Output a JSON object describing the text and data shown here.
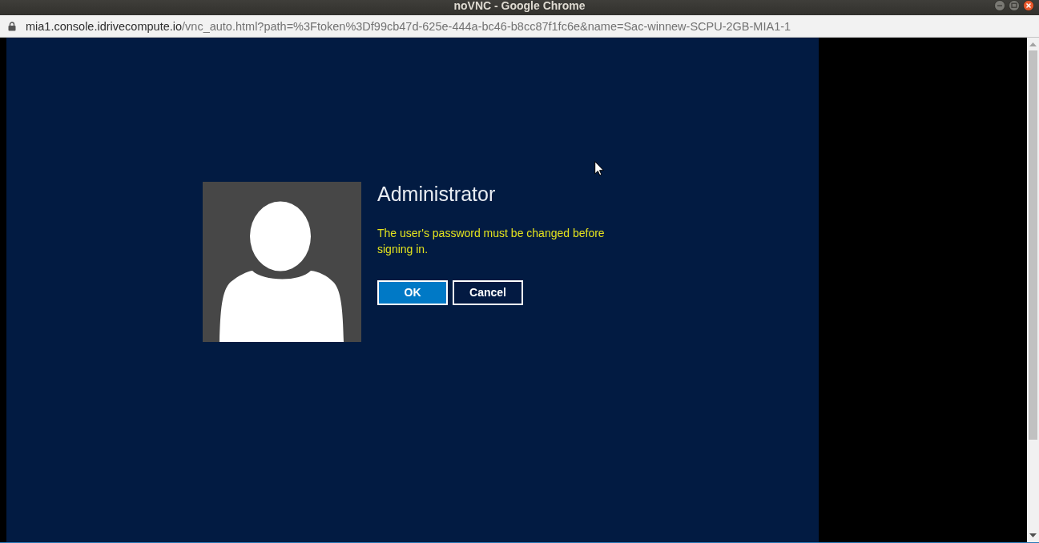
{
  "window": {
    "title": "noVNC - Google Chrome"
  },
  "address_bar": {
    "host": "mia1.console.idrivecompute.io",
    "path": "/vnc_auto.html?path=%3Ftoken%3Df99cb47d-625e-444a-bc46-b8cc87f1fc6e&name=Sac-winnew-SCPU-2GB-MIA1-1"
  },
  "sign_in": {
    "user_name": "Administrator",
    "message": "The user's password must be changed before signing in.",
    "buttons": [
      {
        "label": "OK",
        "kind": "primary"
      },
      {
        "label": "Cancel",
        "kind": "secondary"
      }
    ]
  }
}
